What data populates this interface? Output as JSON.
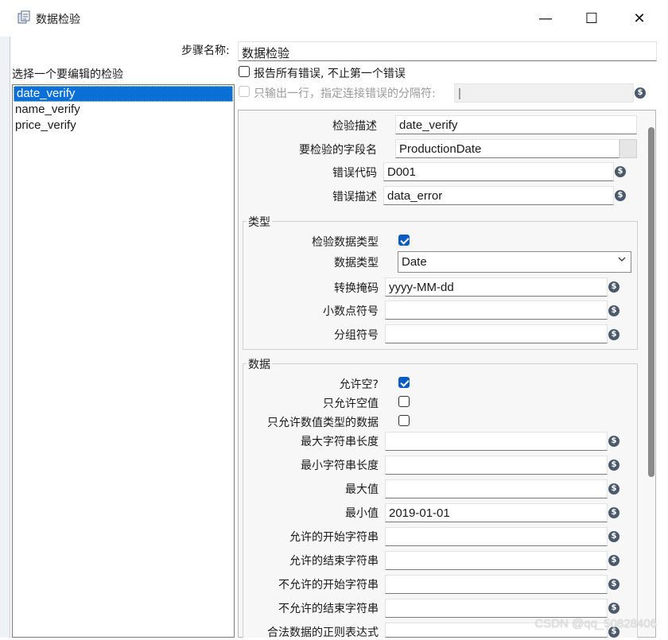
{
  "window": {
    "title": "数据检验",
    "minimize_glyph": "—",
    "maximize_glyph": "☐",
    "close_glyph": "✕"
  },
  "step_name": {
    "label": "步骤名称",
    "value": "数据检验"
  },
  "validations": {
    "label": "选择一个要编辑的检验",
    "items": [
      {
        "label": "date_verify",
        "selected": true
      },
      {
        "label": "name_verify",
        "selected": false
      },
      {
        "label": "price_verify",
        "selected": false
      }
    ]
  },
  "options": {
    "report_all_errors": {
      "label": "报告所有错误, 不止第一个错误",
      "checked": false
    },
    "single_row_output": {
      "label": "只输出一行，指定连接错误的分隔符:",
      "checked": false,
      "disabled": true,
      "value": "|"
    }
  },
  "detail": {
    "description": {
      "label": "检验描述",
      "value": "date_verify"
    },
    "field_name": {
      "label": "要检验的字段名",
      "value": "ProductionDate"
    },
    "error_code": {
      "label": "错误代码",
      "value": "D001"
    },
    "error_desc": {
      "label": "错误描述",
      "value": "data_error"
    }
  },
  "type_group": {
    "title": "类型",
    "check_data_type": {
      "label": "检验数据类型",
      "checked": true
    },
    "data_type": {
      "label": "数据类型",
      "value": "Date"
    },
    "conversion_mask": {
      "label": "转换掩码",
      "value": "yyyy-MM-dd"
    },
    "decimal_symbol": {
      "label": "小数点符号",
      "value": ""
    },
    "grouping_symbol": {
      "label": "分组符号",
      "value": ""
    }
  },
  "data_group": {
    "title": "数据",
    "allow_null": {
      "label": "允许空?",
      "checked": true
    },
    "only_null": {
      "label": "只允许空值",
      "checked": false
    },
    "only_numeric": {
      "label": "只允许数值类型的数据",
      "checked": false
    },
    "max_length": {
      "label": "最大字符串长度",
      "value": ""
    },
    "min_length": {
      "label": "最小字符串长度",
      "value": ""
    },
    "max_value": {
      "label": "最大值",
      "value": ""
    },
    "min_value": {
      "label": "最小值",
      "value": "2019-01-01"
    },
    "allowed_start": {
      "label": "允许的开始字符串",
      "value": ""
    },
    "allowed_end": {
      "label": "允许的结束字符串",
      "value": ""
    },
    "disallowed_start": {
      "label": "不允许的开始字符串",
      "value": ""
    },
    "disallowed_end": {
      "label": "不允许的结束字符串",
      "value": ""
    },
    "regex": {
      "label": "合法数据的正则表达式",
      "value": ""
    }
  },
  "variable_icon": "$",
  "watermark": "CSDN @qq_50828406",
  "colors": {
    "selection": "#0a6fd7",
    "checkbox_on": "#0a5cc2"
  }
}
